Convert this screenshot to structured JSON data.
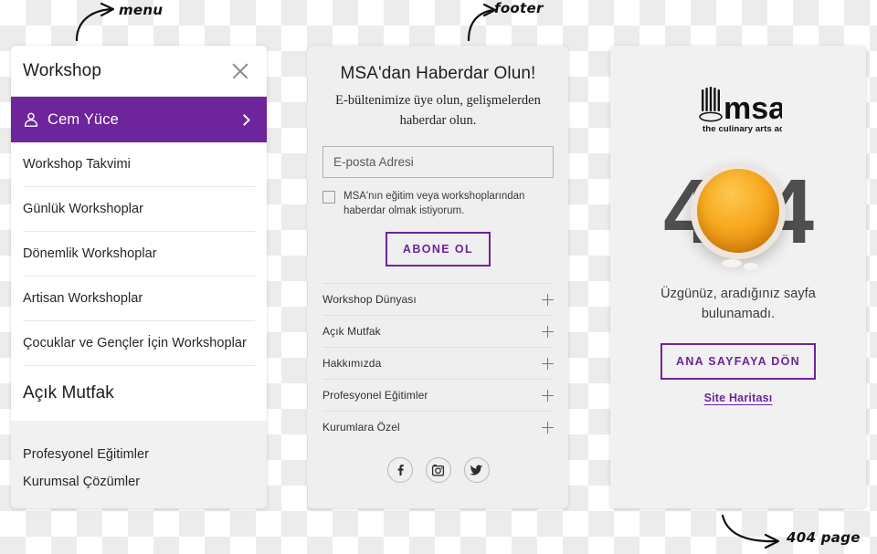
{
  "annotations": [
    {
      "id": "menu",
      "label": "menu"
    },
    {
      "id": "footer",
      "label": "footer"
    },
    {
      "id": "notfound",
      "label": "404 page"
    }
  ],
  "menu_panel": {
    "title": "Workshop",
    "close_icon": "close-icon",
    "active_item": {
      "label": "Cem Yüce",
      "icon": "user-icon",
      "chevron": "chevron-right-icon",
      "accent": "#6e249a"
    },
    "items": [
      {
        "label": "Workshop Takvimi",
        "style": "normal"
      },
      {
        "label": "Günlük Workshoplar",
        "style": "normal"
      },
      {
        "label": "Dönemlik Workshoplar",
        "style": "normal"
      },
      {
        "label": "Artisan Workshoplar",
        "style": "normal"
      },
      {
        "label": "Çocuklar ve Gençler İçin Workshoplar",
        "style": "normal"
      },
      {
        "label": "Açık Mutfak",
        "style": "big"
      }
    ],
    "footer_items": [
      {
        "label": "Profesyonel Eğitimler"
      },
      {
        "label": "Kurumsal Çözümler"
      }
    ]
  },
  "footer_panel": {
    "newsletter": {
      "heading": "MSA'dan Haberdar Olun!",
      "subtitle": "E-bültenimize üye olun, gelişmelerden haberdar olun.",
      "email_placeholder": "E-posta Adresi",
      "email_value": "",
      "consent_label": "MSA'nın eğitim veya workshoplarından haberdar olmak istiyorum.",
      "consent_checked": false,
      "submit_label": "ABONE OL",
      "accent": "#6e249a"
    },
    "accordion": [
      {
        "label": "Workshop Dünyası",
        "toggle": "plus-icon"
      },
      {
        "label": "Açık Mutfak",
        "toggle": "plus-icon"
      },
      {
        "label": "Hakkımızda",
        "toggle": "plus-icon"
      },
      {
        "label": "Profesyonel Eğitimler",
        "toggle": "plus-icon"
      },
      {
        "label": "Kurumlara Özel",
        "toggle": "plus-icon"
      }
    ],
    "socials": [
      {
        "name": "facebook-icon",
        "glyph": "f"
      },
      {
        "name": "instagram-icon",
        "glyph": ""
      },
      {
        "name": "twitter-icon",
        "glyph": ""
      }
    ]
  },
  "notfound_panel": {
    "logo": {
      "wordmark": "msa",
      "tagline": "the culinary arts academy"
    },
    "error_code": "404",
    "error_code_left": "4",
    "error_code_right": "4",
    "message": "Üzgünüz, aradığınız sayfa bulunamadı.",
    "button_label": "ANA SAYFAYA DÖN",
    "link_label": "Site Haritası",
    "accent": "#6e249a",
    "yolk_color": "#f7a81e"
  }
}
